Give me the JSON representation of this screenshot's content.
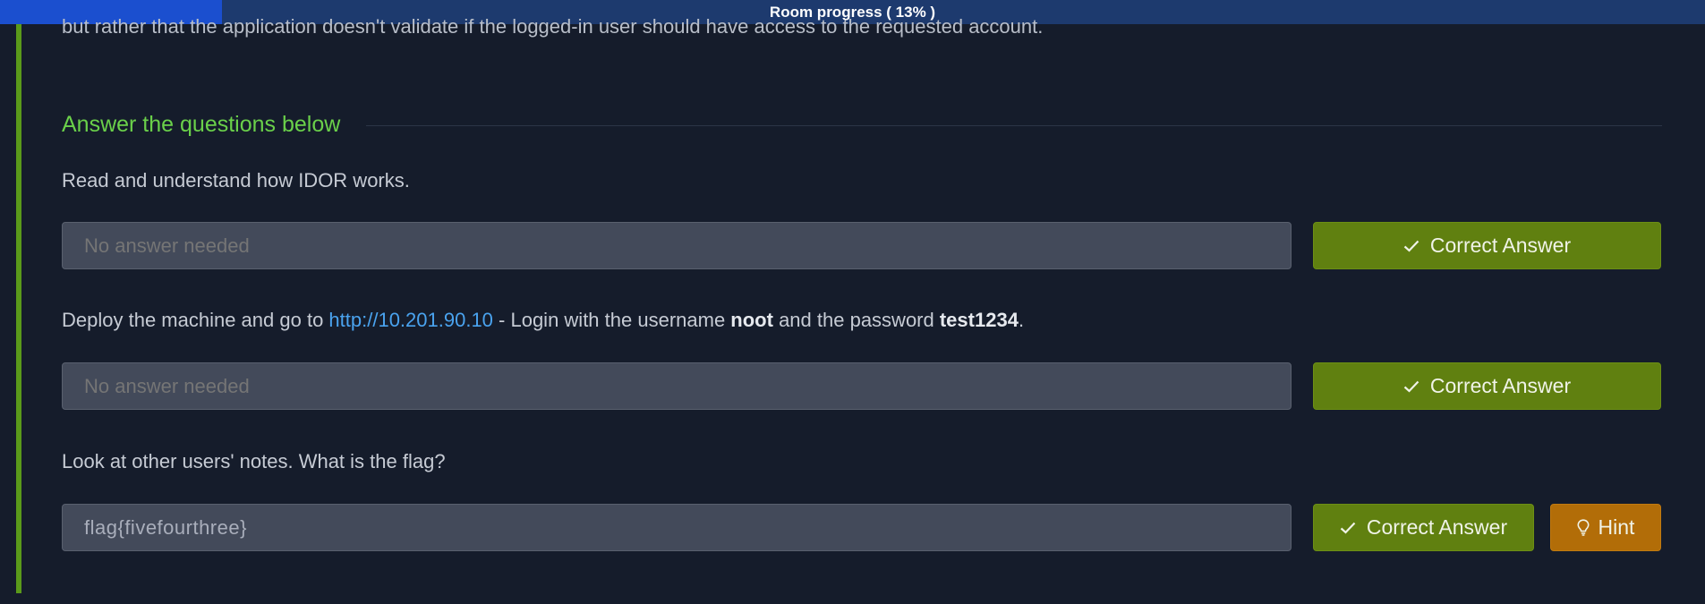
{
  "progress": {
    "label": "Room progress ( 13% )",
    "percent": 13
  },
  "task": {
    "cut_text": "but rather that the application doesn't validate if the logged-in user should have access to the requested account.",
    "heading": "Answer the questions below",
    "questions": [
      {
        "text": "Read and understand how IDOR works.",
        "placeholder": "No answer needed",
        "value": "",
        "button": "Correct Answer"
      },
      {
        "text_before": "Deploy the machine and go to ",
        "link": "http://10.201.90.10",
        "text_mid1": " - Login with the username ",
        "username": "noot",
        "text_mid2": " and the password ",
        "password": "test1234",
        "text_end": ".",
        "placeholder": "No answer needed",
        "value": "",
        "button": "Correct Answer"
      },
      {
        "text": "Look at other users' notes. What is the flag?",
        "placeholder": "",
        "value": "flag{fivefourthree}",
        "button": "Correct Answer",
        "hint": "Hint"
      }
    ]
  },
  "icons": {
    "check": "check-icon",
    "hint": "lightbulb-icon"
  },
  "colors": {
    "accent_green": "#6ad04a",
    "correct_button": "#608010",
    "hint_button": "#b26d08",
    "link": "#4aa3ef",
    "progress_fill": "#1b4fcf"
  }
}
